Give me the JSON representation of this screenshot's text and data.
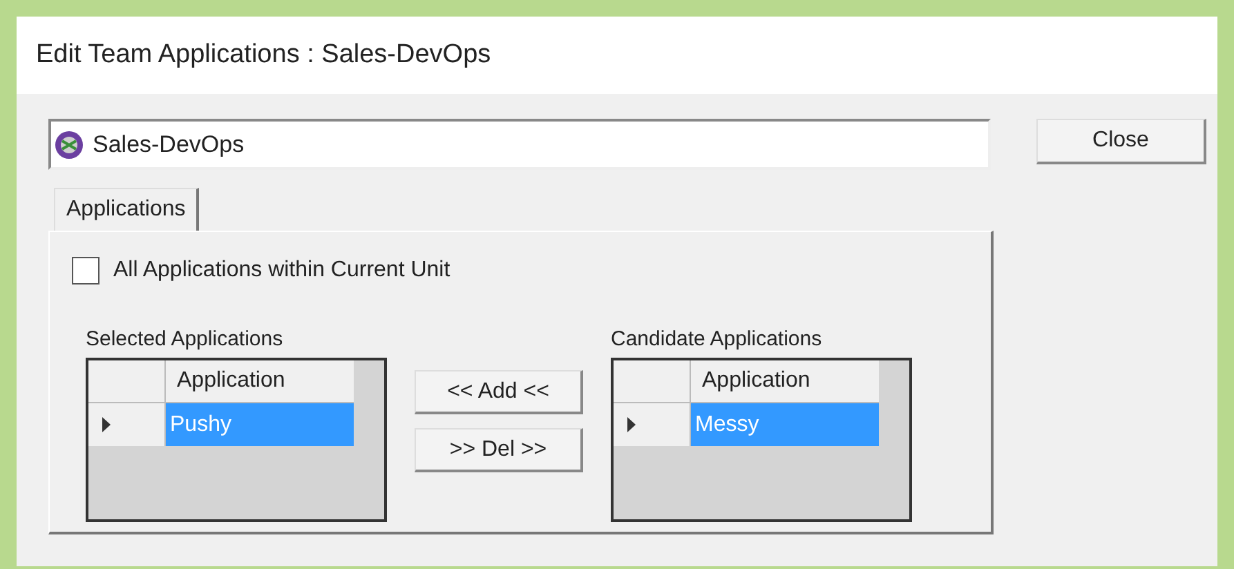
{
  "window": {
    "title": "Edit Team Applications : Sales-DevOps"
  },
  "team_field": {
    "value": "Sales-DevOps"
  },
  "close_button": "Close",
  "tabs": [
    {
      "label": "Applications",
      "selected": true
    }
  ],
  "all_applications": {
    "label": "All Applications within Current Unit",
    "checked": false
  },
  "selected_applications": {
    "title": "Selected Applications",
    "columns": [
      "Application"
    ],
    "rows": [
      {
        "application": "Pushy",
        "selected": true
      }
    ]
  },
  "move_buttons": [
    "<< Add <<",
    ">> Del >>"
  ],
  "candidate_applications": {
    "title": "Candidate Applications",
    "columns": [
      "Application"
    ],
    "rows": [
      {
        "application": "Messy",
        "selected": true
      }
    ]
  }
}
